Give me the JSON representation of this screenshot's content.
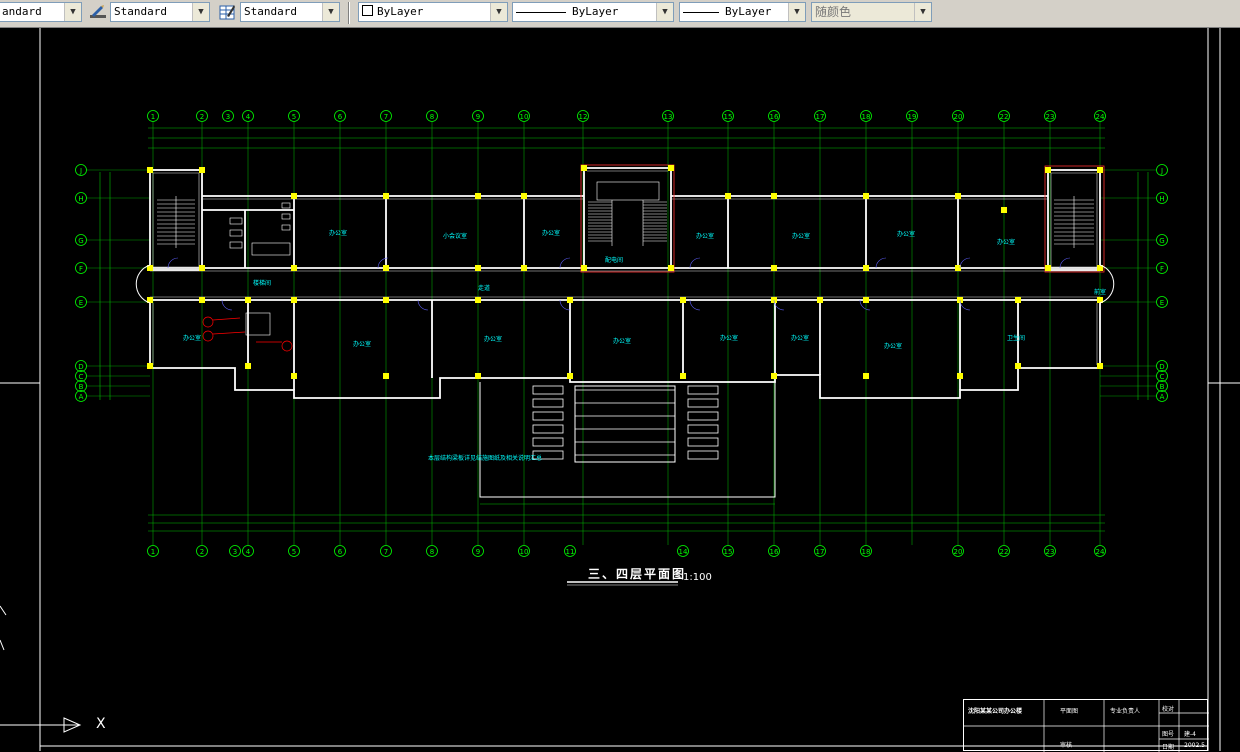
{
  "toolbar": {
    "text_style": "andard",
    "dim_style": "Standard",
    "table_style": "Standard",
    "layer": "ByLayer",
    "linetype": "ByLayer",
    "lineweight": "ByLayer",
    "plot_style": "随颜色"
  },
  "drawing": {
    "title": "三、四层平面图",
    "scale": "1:100",
    "note": "本层结构梁板详见结施图纸及相关说明汇总",
    "grid_top": [
      "1",
      "2",
      "3",
      "4",
      "5",
      "6",
      "7",
      "8",
      "9",
      "10",
      "12",
      "13",
      "15",
      "16",
      "17",
      "18",
      "19",
      "20",
      "22",
      "23",
      "24"
    ],
    "grid_bottom": [
      "1",
      "2",
      "3",
      "4",
      "5",
      "6",
      "7",
      "8",
      "9",
      "10",
      "11",
      "14",
      "15",
      "16",
      "17",
      "18",
      "20",
      "22",
      "23",
      "24"
    ],
    "grid_rows": [
      "J",
      "H",
      "G",
      "F",
      "E",
      "D",
      "C",
      "B",
      "A"
    ],
    "room_labels": [
      "办公室",
      "小会议室",
      "办公室",
      "办公室",
      "办公室",
      "办公室",
      "办公室",
      "走道",
      "办公室",
      "办公室",
      "办公室",
      "办公室",
      "办公室",
      "办公室",
      "办公室",
      "卫生间",
      "配电间",
      "楼梯间",
      "前室"
    ],
    "title_block": {
      "project": "沈阳某某公司办公楼",
      "drawing_name": "平面图",
      "designer": "专业负责人",
      "review": "审核",
      "check": "校对",
      "sheet_label": "图号",
      "sheet_no": "建-4",
      "date_label": "日期",
      "date": "2002.5"
    }
  },
  "colors": {
    "background": "#000000",
    "walls": "#ffffff",
    "grid": "#00ff00",
    "columns": "#ffff00",
    "room_text": "#00ffff",
    "annotation": "#ff0000",
    "toolbar": "#d4d0c8"
  },
  "icons": {
    "dim_style": "dimension-style-icon",
    "table_style": "table-style-icon",
    "ucs": "ucs-icon"
  }
}
